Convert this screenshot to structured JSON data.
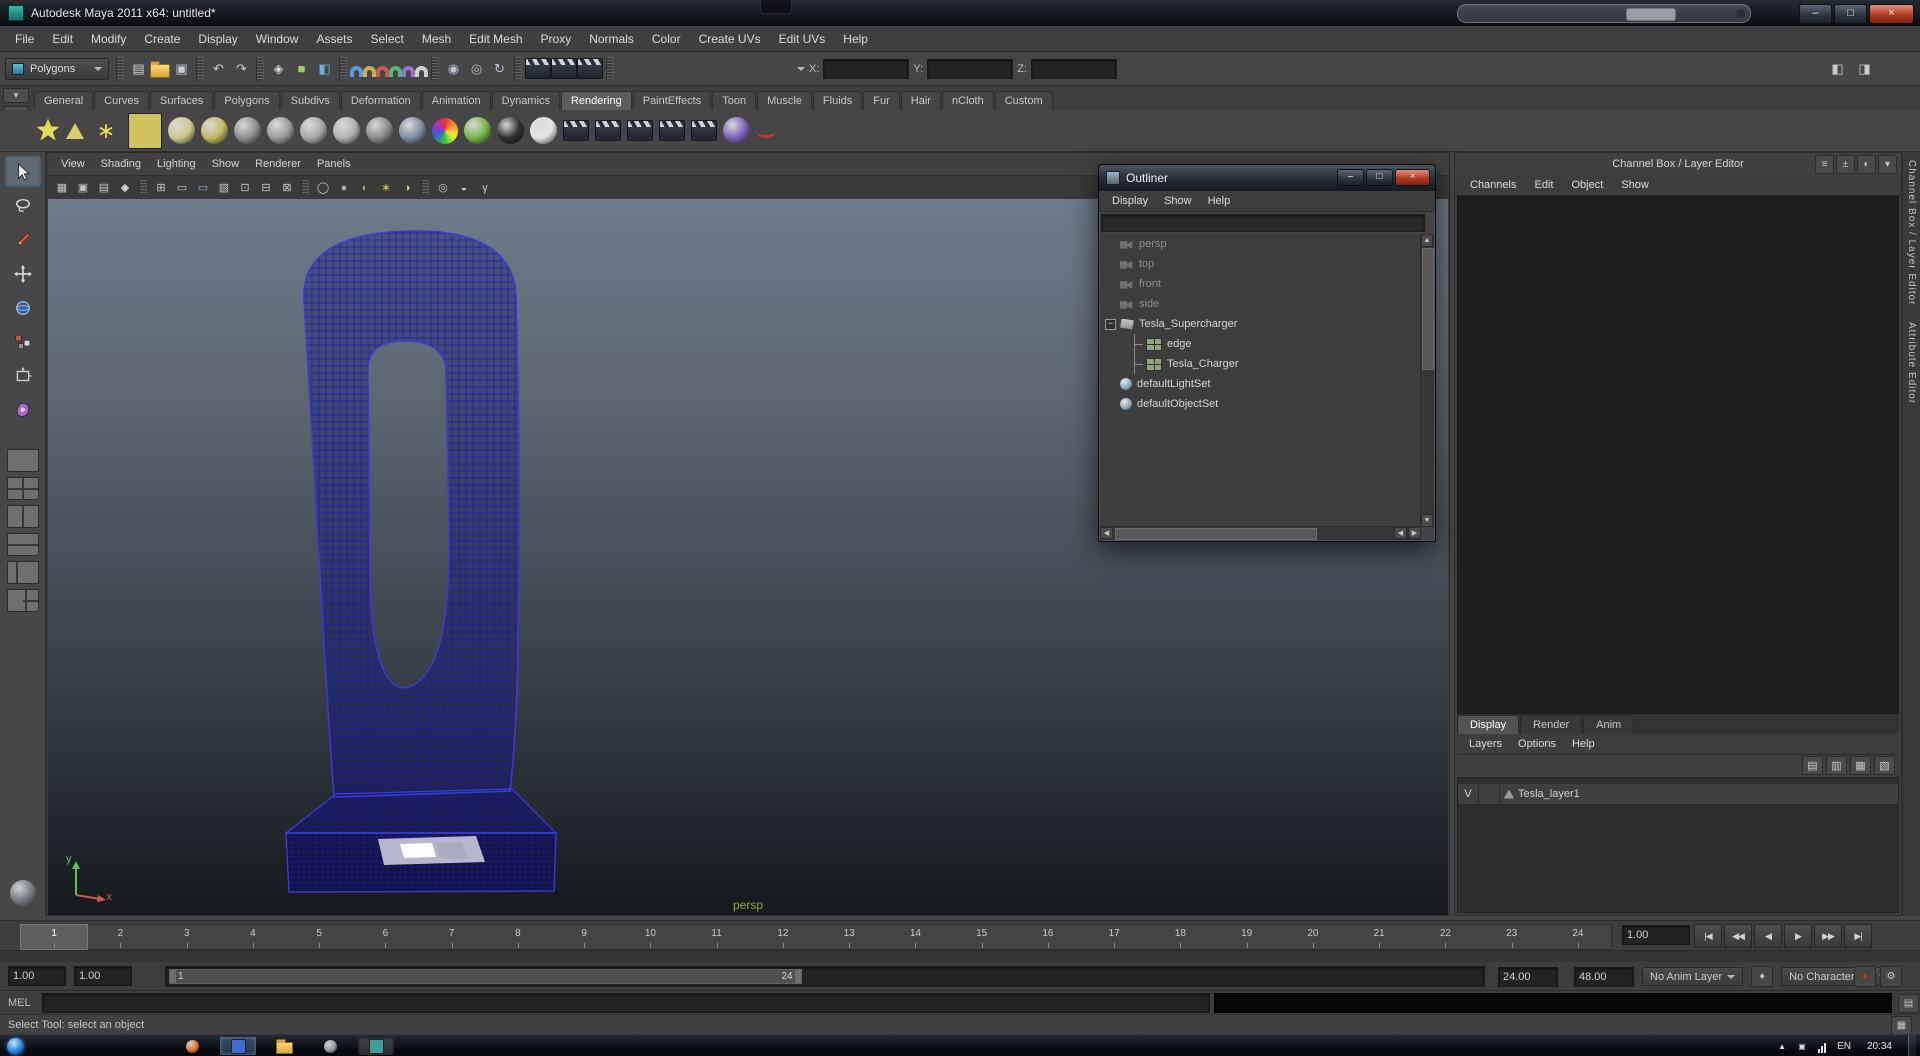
{
  "window": {
    "title": "Autodesk Maya 2011 x64: untitled*",
    "controls": [
      {
        "name": "minimize-button",
        "glyph": "–"
      },
      {
        "name": "maximize-button",
        "glyph": "□"
      },
      {
        "name": "close-button",
        "glyph": "×",
        "close": true
      }
    ]
  },
  "menu_bar": [
    "File",
    "Edit",
    "Modify",
    "Create",
    "Display",
    "Window",
    "Assets",
    "Select",
    "Mesh",
    "Edit Mesh",
    "Proxy",
    "Normals",
    "Color",
    "Create UVs",
    "Edit UVs",
    "Help"
  ],
  "status_line": {
    "menuset_label": "Polygons",
    "icons": [
      {
        "name": "separator-grip",
        "kind": "grip"
      },
      {
        "name": "new-scene-icon",
        "glyph": "▤",
        "color": "#d6d6d6"
      },
      {
        "name": "open-scene-icon",
        "kind": "folder"
      },
      {
        "name": "save-scene-icon",
        "glyph": "▣",
        "color": "#c6cfd8"
      },
      {
        "name": "separator-grip",
        "kind": "grip"
      },
      {
        "name": "undo-icon",
        "glyph": "↶",
        "color": "#cfcfcf"
      },
      {
        "name": "redo-icon",
        "glyph": "↷",
        "color": "#cfcfcf"
      },
      {
        "name": "separator-grip",
        "kind": "grip"
      },
      {
        "name": "select-hierarchy-icon",
        "glyph": "◈",
        "color": "#d8d8d8"
      },
      {
        "name": "select-object-icon",
        "glyph": "■",
        "color": "#9fd06a"
      },
      {
        "name": "select-component-icon",
        "glyph": "◧",
        "color": "#6ab0d8"
      },
      {
        "name": "separator-grip",
        "kind": "grip"
      },
      {
        "name": "snap-to-grid-icon",
        "kind": "magnet",
        "color": "#5a9ae0"
      },
      {
        "name": "snap-to-curve-icon",
        "kind": "magnet",
        "color": "#c8b050"
      },
      {
        "name": "snap-to-point-icon",
        "kind": "magnet",
        "color": "#c85a5a"
      },
      {
        "name": "snap-to-projected-center-icon",
        "kind": "magnet",
        "color": "#58b878"
      },
      {
        "name": "snap-to-view-plane-icon",
        "kind": "magnet",
        "color": "#9a74d0"
      },
      {
        "name": "make-live-icon",
        "kind": "magnet",
        "color": "#cfcfcf"
      },
      {
        "name": "separator-grip",
        "kind": "grip"
      },
      {
        "name": "input-connections-icon",
        "glyph": "◉",
        "color": "#b8c4d0"
      },
      {
        "name": "output-connections-icon",
        "glyph": "◎",
        "color": "#b8c4d0"
      },
      {
        "name": "construction-history-icon",
        "glyph": "↻",
        "color": "#b8c4d0"
      },
      {
        "name": "separator-grip",
        "kind": "grip"
      },
      {
        "name": "render-current-frame-icon",
        "kind": "clap"
      },
      {
        "name": "ipr-render-icon",
        "kind": "clap"
      },
      {
        "name": "render-settings-icon",
        "kind": "clap"
      },
      {
        "name": "separator-grip",
        "kind": "grip"
      }
    ],
    "coords": {
      "x_label": "X:",
      "y_label": "Y:",
      "z_label": "Z:",
      "x_value": "",
      "y_value": "",
      "z_value": ""
    },
    "right_icons": [
      {
        "name": "show-left-panel-icon",
        "glyph": "◧",
        "color": "#c9c9c9"
      },
      {
        "name": "show-right-panel-icon",
        "glyph": "◨",
        "color": "#c9c9c9"
      }
    ]
  },
  "shelf": {
    "controls": [
      {
        "name": "shelf-tab-selector-icon",
        "glyph": "▾"
      },
      {
        "name": "shelf-menu-icon",
        "glyph": "≡"
      }
    ],
    "tabs": [
      "General",
      "Curves",
      "Surfaces",
      "Polygons",
      "Subdivs",
      "Deformation",
      "Animation",
      "Dynamics",
      "Rendering",
      "PaintEffects",
      "Toon",
      "Muscle",
      "Fluids",
      "Fur",
      "Hair",
      "nCloth",
      "Custom"
    ],
    "active_tab": "Rendering",
    "icons": [
      {
        "name": "point-light-icon",
        "kind": "star",
        "color": "#e6da5a"
      },
      {
        "name": "spot-light-icon",
        "kind": "cone",
        "color": "#d8ce6e"
      },
      {
        "name": "directional-light-icon",
        "glyph": "∗",
        "color": "#e6da5a",
        "size": 22
      },
      {
        "name": "area-light-icon",
        "kind": "box",
        "color": "#cfc25e"
      },
      {
        "name": "ambient-light-icon",
        "kind": "sphere",
        "color": "#cfc98e"
      },
      {
        "name": "volume-light-icon",
        "kind": "sphere",
        "color": "#c2b964"
      },
      {
        "name": "anisotropic-material-icon",
        "kind": "sphere",
        "color": "#8f8f8f"
      },
      {
        "name": "blinn-material-icon",
        "kind": "sphere",
        "color": "#9c9c9c"
      },
      {
        "name": "lambert-material-icon",
        "kind": "sphere",
        "color": "#a8a8a8"
      },
      {
        "name": "phong-material-icon",
        "kind": "sphere",
        "color": "#b2b2b2"
      },
      {
        "name": "phong-e-material-icon",
        "kind": "sphere",
        "color": "#8a8a8a"
      },
      {
        "name": "layered-shader-icon",
        "kind": "sphere",
        "color": "#7e8ea2"
      },
      {
        "name": "ramp-shader-icon",
        "kind": "rainbow"
      },
      {
        "name": "shading-map-icon",
        "kind": "sphere",
        "color": "#7ab648"
      },
      {
        "name": "surface-shader-icon",
        "kind": "sphere",
        "color": "#303030"
      },
      {
        "name": "use-background-icon",
        "kind": "sphere",
        "color": "#e4e4e4"
      },
      {
        "name": "render-settings-shelf-icon",
        "kind": "clap"
      },
      {
        "name": "ipr-render-shelf-icon",
        "kind": "clap"
      },
      {
        "name": "render-view-icon",
        "kind": "clap"
      },
      {
        "name": "hypershade-icon",
        "kind": "clap"
      },
      {
        "name": "batch-render-icon",
        "kind": "clap"
      },
      {
        "name": "shading-group-icon",
        "kind": "sphere",
        "color": "#7a62b8"
      },
      {
        "name": "paint-effects-icon",
        "kind": "stroke",
        "color": "#c0392b"
      }
    ]
  },
  "toolbox": {
    "tools": [
      {
        "name": "select-tool-button",
        "kind": "tool-select",
        "active": true
      },
      {
        "name": "lasso-tool-button",
        "kind": "tool-lasso"
      },
      {
        "name": "paint-select-tool-button",
        "kind": "tool-brush"
      },
      {
        "name": "move-tool-button",
        "kind": "tool-move"
      },
      {
        "name": "rotate-tool-button",
        "kind": "tool-rotate"
      },
      {
        "name": "scale-tool-button",
        "kind": "tool-scale"
      },
      {
        "name": "universal-manipulator-button",
        "kind": "tool-universal"
      },
      {
        "name": "soft-mod-tool-button",
        "kind": "tool-softmod"
      }
    ],
    "layouts": [
      {
        "name": "single-pane-layout-button",
        "kind": "lay-single"
      },
      {
        "name": "four-pane-layout-button",
        "kind": "lay-four"
      },
      {
        "name": "two-pane-side-layout-button",
        "kind": "lay-2v"
      },
      {
        "name": "two-pane-stacked-layout-button",
        "kind": "lay-2h"
      },
      {
        "name": "persp-outliner-layout-button",
        "kind": "lay-out"
      },
      {
        "name": "persp-graph-layout-button",
        "kind": "lay-3"
      }
    ]
  },
  "viewport": {
    "menus": [
      "View",
      "Shading",
      "Lighting",
      "Show",
      "Renderer",
      "Panels"
    ],
    "iconbar": [
      {
        "name": "select-camera-icon",
        "glyph": "▦",
        "color": "#c8c8c8"
      },
      {
        "name": "lock-camera-icon",
        "glyph": "▣",
        "color": "#c8c8c8"
      },
      {
        "name": "camera-attributes-icon",
        "glyph": "▤",
        "color": "#c8c8c8"
      },
      {
        "name": "bookmarks-icon",
        "glyph": "◆",
        "color": "#c8c8c8"
      },
      {
        "name": "separator-grip",
        "kind": "grip"
      },
      {
        "name": "grid-icon",
        "glyph": "⊞",
        "color": "#c8c8c8"
      },
      {
        "name": "film-gate-icon",
        "glyph": "▭",
        "color": "#c8c8c8"
      },
      {
        "name": "resolution-gate-icon",
        "glyph": "▭",
        "color": "#9ab0c4"
      },
      {
        "name": "gate-mask-icon",
        "glyph": "▧",
        "color": "#c8c8c8"
      },
      {
        "name": "field-chart-icon",
        "glyph": "⊡",
        "color": "#c8c8c8"
      },
      {
        "name": "safe-action-icon",
        "glyph": "⊟",
        "color": "#c8c8c8"
      },
      {
        "name": "safe-title-icon",
        "glyph": "⊠",
        "color": "#c8c8c8"
      },
      {
        "name": "separator-grip",
        "kind": "grip"
      },
      {
        "name": "wireframe-icon",
        "glyph": "◯",
        "color": "#c8c8c8"
      },
      {
        "name": "smooth-shade-icon",
        "glyph": "●",
        "color": "#b0b0b0"
      },
      {
        "name": "textured-icon",
        "glyph": "◐",
        "color": "#8fb060"
      },
      {
        "name": "use-lights-icon",
        "glyph": "∗",
        "color": "#e0cf5a"
      },
      {
        "name": "shadows-icon",
        "glyph": "◑",
        "color": "#d8d06a"
      },
      {
        "name": "separator-grip",
        "kind": "grip"
      },
      {
        "name": "isolate-select-icon",
        "glyph": "◎",
        "color": "#c8c8c8"
      },
      {
        "name": "xray-icon",
        "glyph": "◒",
        "color": "#c8c8c8"
      },
      {
        "name": "exposure-icon",
        "glyph": "γ",
        "color": "#c8c8c8"
      }
    ],
    "camera_label": "persp",
    "axis_y": "y",
    "axis_x": "x"
  },
  "outliner": {
    "title": "Outliner",
    "menus": [
      "Display",
      "Show",
      "Help"
    ],
    "items": [
      {
        "label": "persp",
        "icon": "cam",
        "muted": true,
        "expander": ""
      },
      {
        "label": "top",
        "icon": "cam",
        "muted": true,
        "expander": ""
      },
      {
        "label": "front",
        "icon": "cam",
        "muted": true,
        "expander": ""
      },
      {
        "label": "side",
        "icon": "cam",
        "muted": true,
        "expander": ""
      },
      {
        "label": "Tesla_Supercharger",
        "icon": "xform",
        "expander": "−"
      },
      {
        "label": "edge",
        "icon": "mesh",
        "child": true,
        "expander": ""
      },
      {
        "label": "Tesla_Charger",
        "icon": "mesh",
        "child": true,
        "expander": ""
      },
      {
        "label": "defaultLightSet",
        "icon": "set",
        "expander": ""
      },
      {
        "label": "defaultObjectSet",
        "icon": "set",
        "expander": ""
      }
    ]
  },
  "channel_box": {
    "header": "Channel Box / Layer Editor",
    "header_icons": [
      {
        "name": "channel-sliders-icon",
        "glyph": "≡"
      },
      {
        "name": "channel-speed-icon",
        "glyph": "±"
      },
      {
        "name": "channel-mode-icon",
        "glyph": "◐"
      },
      {
        "name": "panel-menu-icon",
        "glyph": "▾"
      }
    ],
    "menus": [
      "Channels",
      "Edit",
      "Object",
      "Show"
    ],
    "layer_tabs": [
      "Display",
      "Render",
      "Anim"
    ],
    "active_layer_tab": "Display",
    "layer_menus": [
      "Layers",
      "Options",
      "Help"
    ],
    "layer_toolbar": [
      {
        "name": "new-empty-layer-icon",
        "glyph": "▤"
      },
      {
        "name": "new-layer-from-selected-icon",
        "glyph": "▥"
      },
      {
        "name": "edit-layer-icon",
        "glyph": "▦"
      },
      {
        "name": "delete-layer-icon",
        "glyph": "▧"
      }
    ],
    "layers": [
      {
        "visibility": "V",
        "name": "Tesla_layer1"
      }
    ]
  },
  "right_tabs": [
    "Channel Box / Layer Editor",
    "Attribute Editor"
  ],
  "timeline": {
    "frames": [
      "1",
      "2",
      "3",
      "4",
      "5",
      "6",
      "7",
      "8",
      "9",
      "10",
      "11",
      "12",
      "13",
      "14",
      "15",
      "16",
      "17",
      "18",
      "19",
      "20",
      "21",
      "22",
      "23",
      "24"
    ],
    "current_frame": "1",
    "current_time": "1.00",
    "playback": [
      {
        "name": "go-to-start-icon",
        "glyph": "|◀"
      },
      {
        "name": "step-back-frame-icon",
        "glyph": "◀◀"
      },
      {
        "name": "play-backwards-icon",
        "glyph": "◀"
      },
      {
        "name": "play-forwards-icon",
        "glyph": "▶"
      },
      {
        "name": "step-forward-frame-icon",
        "glyph": "▶▶"
      },
      {
        "name": "go-to-end-icon",
        "glyph": "▶|"
      }
    ]
  },
  "range_slider": {
    "anim_start": "1.00",
    "playback_start": "1.00",
    "range_start": "1",
    "range_end": "24",
    "playback_end": "24.00",
    "anim_end": "48.00",
    "anim_layer": "No Anim Layer",
    "character_set": "No Character Set",
    "key_icon": [
      {
        "name": "anim-layer-key-icon",
        "glyph": "♦",
        "color": "#c8c8c8"
      }
    ],
    "right_icons": [
      {
        "name": "auto-keyframe-icon",
        "glyph": "●",
        "color": "#c0392b"
      },
      {
        "name": "animation-preferences-icon",
        "glyph": "⚙",
        "color": "#c8c8c8"
      }
    ]
  },
  "command_line": {
    "label": "MEL",
    "value": "",
    "editor_icons": [
      {
        "name": "script-editor-icon",
        "glyph": "▤",
        "color": "#c6c6c6"
      }
    ]
  },
  "help_line": {
    "text": "Select Tool: select an object",
    "icons": [
      {
        "name": "quick-help-icon",
        "glyph": "▦",
        "color": "#c6c6c6"
      }
    ]
  },
  "taskbar": {
    "language": "EN",
    "clock": "20:34",
    "buttons": [
      {
        "name": "firefox-icon",
        "kind": "sphere",
        "color": "#e8762d"
      },
      {
        "name": "blue-app-icon",
        "kind": "box",
        "color": "#3a6ed0",
        "active": true
      },
      {
        "name": "explorer-icon",
        "kind": "folder"
      },
      {
        "name": "browser-icon",
        "kind": "sphere",
        "color": "#9aa2a8"
      },
      {
        "name": "maya-task-icon",
        "kind": "box",
        "color": "#3f9e96",
        "pressed": true
      }
    ],
    "tray": [
      {
        "name": "hidden-icons-icon",
        "glyph": "▲",
        "color": "#dfe6ee"
      },
      {
        "name": "notification-icon",
        "glyph": "▣",
        "color": "#d8dde2"
      },
      {
        "name": "network-icon",
        "kind": "bars"
      }
    ]
  }
}
